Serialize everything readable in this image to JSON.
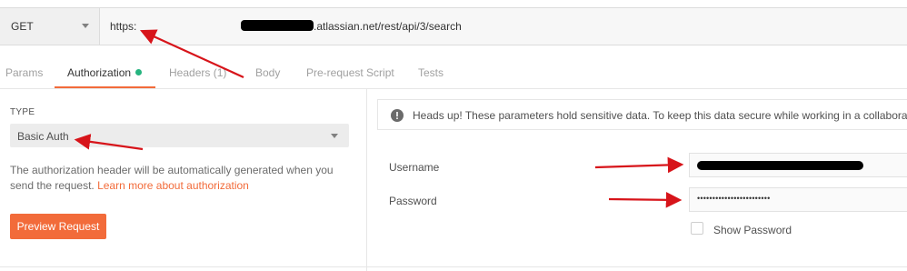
{
  "request": {
    "method": "GET",
    "url_prefix": "https:",
    "url_suffix": ".atlassian.net/rest/api/3/search"
  },
  "tabs": [
    {
      "label": "Params",
      "active": false
    },
    {
      "label": "Authorization",
      "active": true,
      "status_dot_color": "#26b47f"
    },
    {
      "label": "Headers (1)",
      "active": false
    },
    {
      "label": "Body",
      "active": false
    },
    {
      "label": "Pre-request Script",
      "active": false
    },
    {
      "label": "Tests",
      "active": false
    }
  ],
  "auth": {
    "type_label": "TYPE",
    "type_value": "Basic Auth",
    "help_text": "The authorization header will be automatically generated when you send the request.",
    "learn_link": "Learn more about authorization",
    "preview_button": "Preview Request"
  },
  "notice": {
    "icon": "info-icon",
    "text": "Heads up! These parameters hold sensitive data. To keep this data secure while working in a collaborativ"
  },
  "credentials": {
    "username_label": "Username",
    "password_label": "Password",
    "password_value": "••••••••••••••••••••••••",
    "show_password_label": "Show Password",
    "show_password_checked": false
  },
  "colors": {
    "accent": "#f26b3a",
    "annotation_arrow": "#d7141a",
    "status_dot": "#26b47f"
  }
}
